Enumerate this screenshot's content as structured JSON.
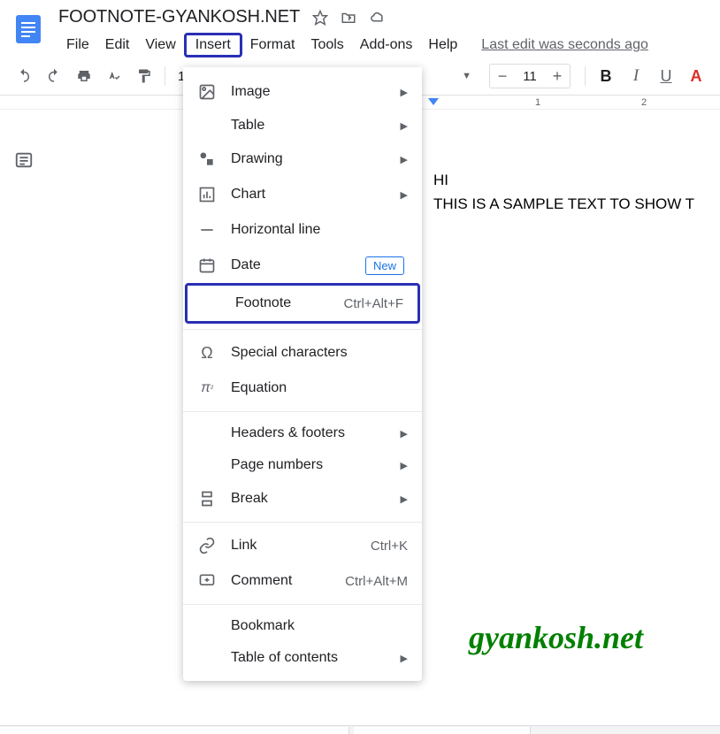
{
  "doc": {
    "title": "FOOTNOTE-GYANKOSH.NET",
    "last_edit": "Last edit was seconds ago"
  },
  "menubar": {
    "file": "File",
    "edit": "Edit",
    "view": "View",
    "insert": "Insert",
    "format": "Format",
    "tools": "Tools",
    "addons": "Add-ons",
    "help": "Help"
  },
  "toolbar": {
    "zoom": "1",
    "font_size": "11",
    "bold": "B",
    "italic": "I",
    "underline": "U",
    "text_color": "A"
  },
  "ruler": {
    "n1": "1",
    "n2": "2"
  },
  "dropdown": {
    "image": "Image",
    "table": "Table",
    "drawing": "Drawing",
    "chart": "Chart",
    "horizontal_line": "Horizontal line",
    "date": "Date",
    "date_badge": "New",
    "footnote": "Footnote",
    "footnote_shortcut": "Ctrl+Alt+F",
    "special_chars": "Special characters",
    "equation": "Equation",
    "headers_footers": "Headers & footers",
    "page_numbers": "Page numbers",
    "break": "Break",
    "link": "Link",
    "link_shortcut": "Ctrl+K",
    "comment": "Comment",
    "comment_shortcut": "Ctrl+Alt+M",
    "bookmark": "Bookmark",
    "toc": "Table of contents"
  },
  "content": {
    "line1": "HI",
    "line2": "THIS IS A SAMPLE TEXT TO SHOW T"
  },
  "watermark": "gyankosh.net"
}
